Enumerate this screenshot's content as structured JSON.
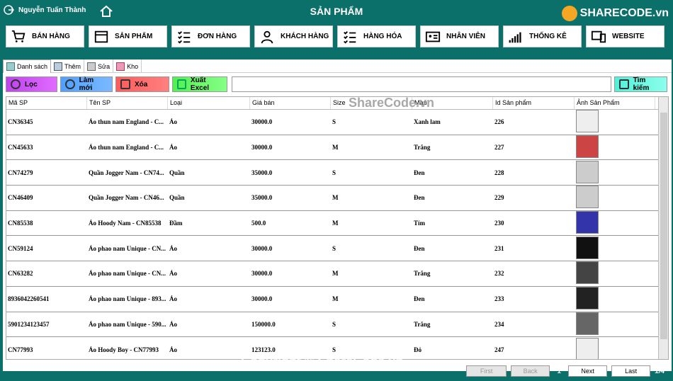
{
  "header": {
    "user_name": "Nguyễn Tuấn Thành",
    "page_title": "SẢN PHẨM",
    "logo_text": "SHARECODE.vn"
  },
  "nav": [
    {
      "label": "BÁN HÀNG",
      "icon": "cart-icon"
    },
    {
      "label": "SẢN PHẨM",
      "icon": "box-icon"
    },
    {
      "label": "ĐƠN HÀNG",
      "icon": "checklist-icon"
    },
    {
      "label": "KHÁCH HÀNG",
      "icon": "person-icon"
    },
    {
      "label": "HÀNG HÓA",
      "icon": "checklist-icon"
    },
    {
      "label": "NHÂN VIÊN",
      "icon": "id-card-icon"
    },
    {
      "label": "THỐNG KÊ",
      "icon": "bar-chart-icon"
    },
    {
      "label": "WEBSITE",
      "icon": "devices-icon"
    }
  ],
  "tabs": [
    "Danh sách",
    "Thêm",
    "Sửa",
    "Kho"
  ],
  "toolbar": {
    "filter": "Lọc",
    "refresh": "Làm mới",
    "delete": "Xóa",
    "export": "Xuất Excel",
    "search": "Tìm kiếm",
    "search_placeholder": ""
  },
  "table": {
    "columns": [
      "Mã SP",
      "Tên SP",
      "Loại",
      "Giá bán",
      "Size",
      "Màu",
      "Id Sản phẩm",
      "Ảnh Sản Phẩm"
    ],
    "rows": [
      [
        "CN36345",
        "Áo thun nam England - C...",
        "Áo",
        "30000.0",
        "S",
        "Xanh lam",
        "226"
      ],
      [
        "CN45633",
        "Áo thun nam England - C...",
        "Áo",
        "30000.0",
        "M",
        "Trắng",
        "227"
      ],
      [
        "CN74279",
        "Quần Jogger Nam - CN74...",
        "Quần",
        "35000.0",
        "S",
        "Đen",
        "228"
      ],
      [
        "CN46409",
        "Quần Jogger Nam - CN46...",
        "Quần",
        "35000.0",
        "M",
        "Đen",
        "229"
      ],
      [
        "CN85538",
        "Áo Hoody Nam - CN85538",
        "Đầm",
        "500.0",
        "M",
        "Tím",
        "230"
      ],
      [
        "CN59124",
        "Áo phao nam Unique - CN...",
        "Áo",
        "30000.0",
        "S",
        "Đen",
        "231"
      ],
      [
        "CN63282",
        "Áo phao nam Unique - CN...",
        "Áo",
        "30000.0",
        "M",
        "Trắng",
        "232"
      ],
      [
        "8936042260541",
        "Áo phao nam Unique - 893...",
        "Áo",
        "30000.0",
        "M",
        "Đen",
        "233"
      ],
      [
        "5901234123457",
        "Áo phao nam Unique - 590...",
        "Áo",
        "150000.0",
        "S",
        "Trắng",
        "234"
      ],
      [
        "CN77993",
        "Áo Hoody Boy - CN77993",
        "Áo",
        "123123.0",
        "S",
        "Đỏ",
        "247"
      ]
    ]
  },
  "pager": {
    "first": "First",
    "back": "Back",
    "current": "1",
    "next": "Next",
    "last": "Last",
    "summary": "1/4"
  },
  "watermarks": [
    "ShareCode.vn",
    "Copyright © ShareCode.vn"
  ]
}
